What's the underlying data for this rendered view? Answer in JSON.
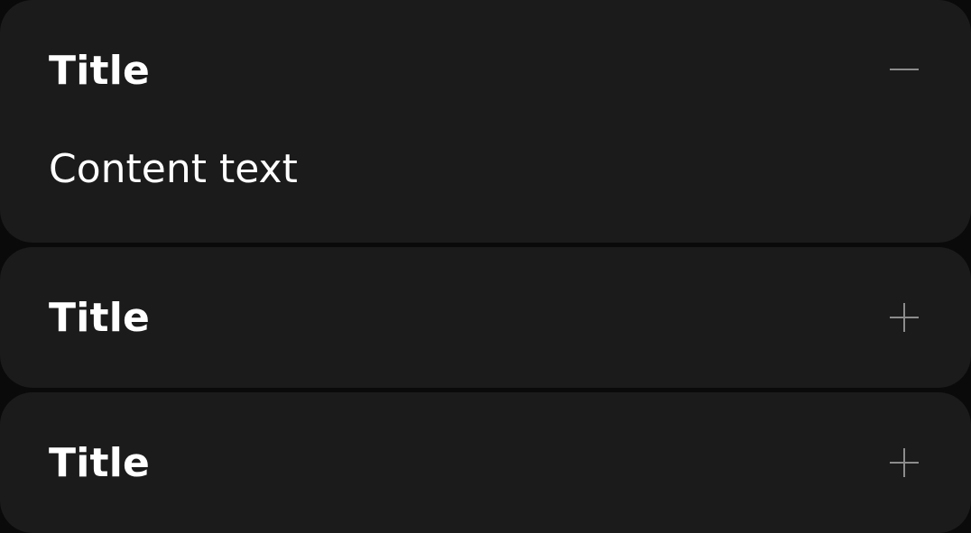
{
  "accordion": {
    "items": [
      {
        "title": "Title",
        "expanded": true,
        "toggle_icon": "minus-icon",
        "content": "Content text"
      },
      {
        "title": "Title",
        "expanded": false,
        "toggle_icon": "plus-icon"
      },
      {
        "title": "Title",
        "expanded": false,
        "toggle_icon": "plus-icon"
      }
    ]
  },
  "colors": {
    "background": "#0a0a0a",
    "panel": "#1b1b1b",
    "text": "#ffffff",
    "icon": "#8c8c8c"
  }
}
